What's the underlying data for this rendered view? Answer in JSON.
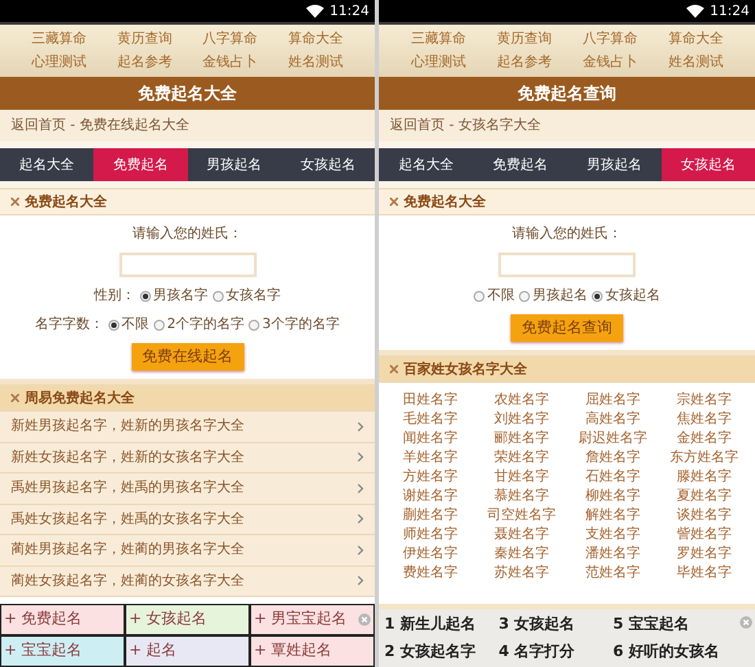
{
  "screens": [
    {
      "status_bar": {
        "time": "11:24"
      },
      "nav_links": [
        "三藏算命",
        "黄历查询",
        "八字算命",
        "算命大全",
        "心理测试",
        "起名参考",
        "金钱占卜",
        "姓名测试"
      ],
      "title": "免费起名大全",
      "breadcrumb": "返回首页 - 免费在线起名大全",
      "tabs": [
        {
          "label": "起名大全",
          "selected": false
        },
        {
          "label": "免费起名",
          "selected": true
        },
        {
          "label": "男孩起名",
          "selected": false
        },
        {
          "label": "女孩起名",
          "selected": false
        }
      ],
      "form": {
        "heading": "免费起名大全",
        "prompt": "请输入您的姓氏：",
        "radio_groups": [
          {
            "label": "性别：",
            "options": [
              {
                "label": "男孩名字",
                "selected": true
              },
              {
                "label": "女孩名字",
                "selected": false
              }
            ]
          },
          {
            "label": "名字字数：",
            "options": [
              {
                "label": "不限",
                "selected": true
              },
              {
                "label": "2个字的名字",
                "selected": false
              },
              {
                "label": "3个字的名字",
                "selected": false
              }
            ]
          }
        ],
        "button": "免费在线起名"
      },
      "section": {
        "kind": "list",
        "heading": "周易免费起名大全",
        "items": [
          "新姓男孩起名字，姓新的男孩名字大全",
          "新姓女孩起名字，姓新的女孩名字大全",
          "禹姓男孩起名字，姓禹的男孩名字大全",
          "禹姓女孩起名字，姓禹的女孩名字大全",
          "蔺姓男孩起名字，姓蔺的男孩名字大全",
          "蔺姓女孩起名字，姓蔺的女孩名字大全"
        ]
      },
      "ad": {
        "kind": "tiles",
        "items": [
          {
            "label": "+ 免费起名",
            "color": "#fbe1e1"
          },
          {
            "label": "+ 女孩起名",
            "color": "#e7f4dc"
          },
          {
            "label": "+ 男宝宝起名",
            "color": "#fbe1e1"
          },
          {
            "label": "+ 宝宝起名",
            "color": "#cdeff4"
          },
          {
            "label": "+ 起名",
            "color": "#e8e8f4"
          },
          {
            "label": "+ 覃姓起名",
            "color": "#fbe1e1"
          }
        ]
      }
    },
    {
      "status_bar": {
        "time": "11:24"
      },
      "nav_links": [
        "三藏算命",
        "黄历查询",
        "八字算命",
        "算命大全",
        "心理测试",
        "起名参考",
        "金钱占卜",
        "姓名测试"
      ],
      "title": "免费起名查询",
      "breadcrumb": "返回首页 - 女孩名字大全",
      "tabs": [
        {
          "label": "起名大全",
          "selected": false
        },
        {
          "label": "免费起名",
          "selected": false
        },
        {
          "label": "男孩起名",
          "selected": false
        },
        {
          "label": "女孩起名",
          "selected": true
        }
      ],
      "form": {
        "heading": "免费起名大全",
        "prompt": "请输入您的姓氏：",
        "radio_groups": [
          {
            "options": [
              {
                "label": "不限",
                "selected": false
              },
              {
                "label": "男孩起名",
                "selected": false
              },
              {
                "label": "女孩起名",
                "selected": true
              }
            ]
          }
        ],
        "button": "免费起名查询"
      },
      "section": {
        "kind": "grid",
        "heading": "百家姓女孩名字大全",
        "items": [
          "田姓名字",
          "农姓名字",
          "屈姓名字",
          "宗姓名字",
          "毛姓名字",
          "刘姓名字",
          "高姓名字",
          "焦姓名字",
          "闻姓名字",
          "郦姓名字",
          "尉迟姓名字",
          "金姓名字",
          "羊姓名字",
          "荣姓名字",
          "詹姓名字",
          "东方姓名字",
          "方姓名字",
          "甘姓名字",
          "石姓名字",
          "滕姓名字",
          "谢姓名字",
          "慕姓名字",
          "柳姓名字",
          "夏姓名字",
          "蒯姓名字",
          "司空姓名字",
          "解姓名字",
          "谈姓名字",
          "师姓名字",
          "聂姓名字",
          "支姓名字",
          "訾姓名字",
          "伊姓名字",
          "秦姓名字",
          "潘姓名字",
          "罗姓名字",
          "费姓名字",
          "苏姓名字",
          "范姓名字",
          "毕姓名字"
        ]
      },
      "ad": {
        "kind": "numbered",
        "items": [
          {
            "number": "1",
            "label": "新生儿起名"
          },
          {
            "number": "3",
            "label": "女孩起名"
          },
          {
            "number": "5",
            "label": "宝宝起名"
          },
          {
            "number": "2",
            "label": "女孩起名字"
          },
          {
            "number": "4",
            "label": "名字打分"
          },
          {
            "number": "6",
            "label": "好听的女孩名"
          }
        ]
      }
    }
  ]
}
